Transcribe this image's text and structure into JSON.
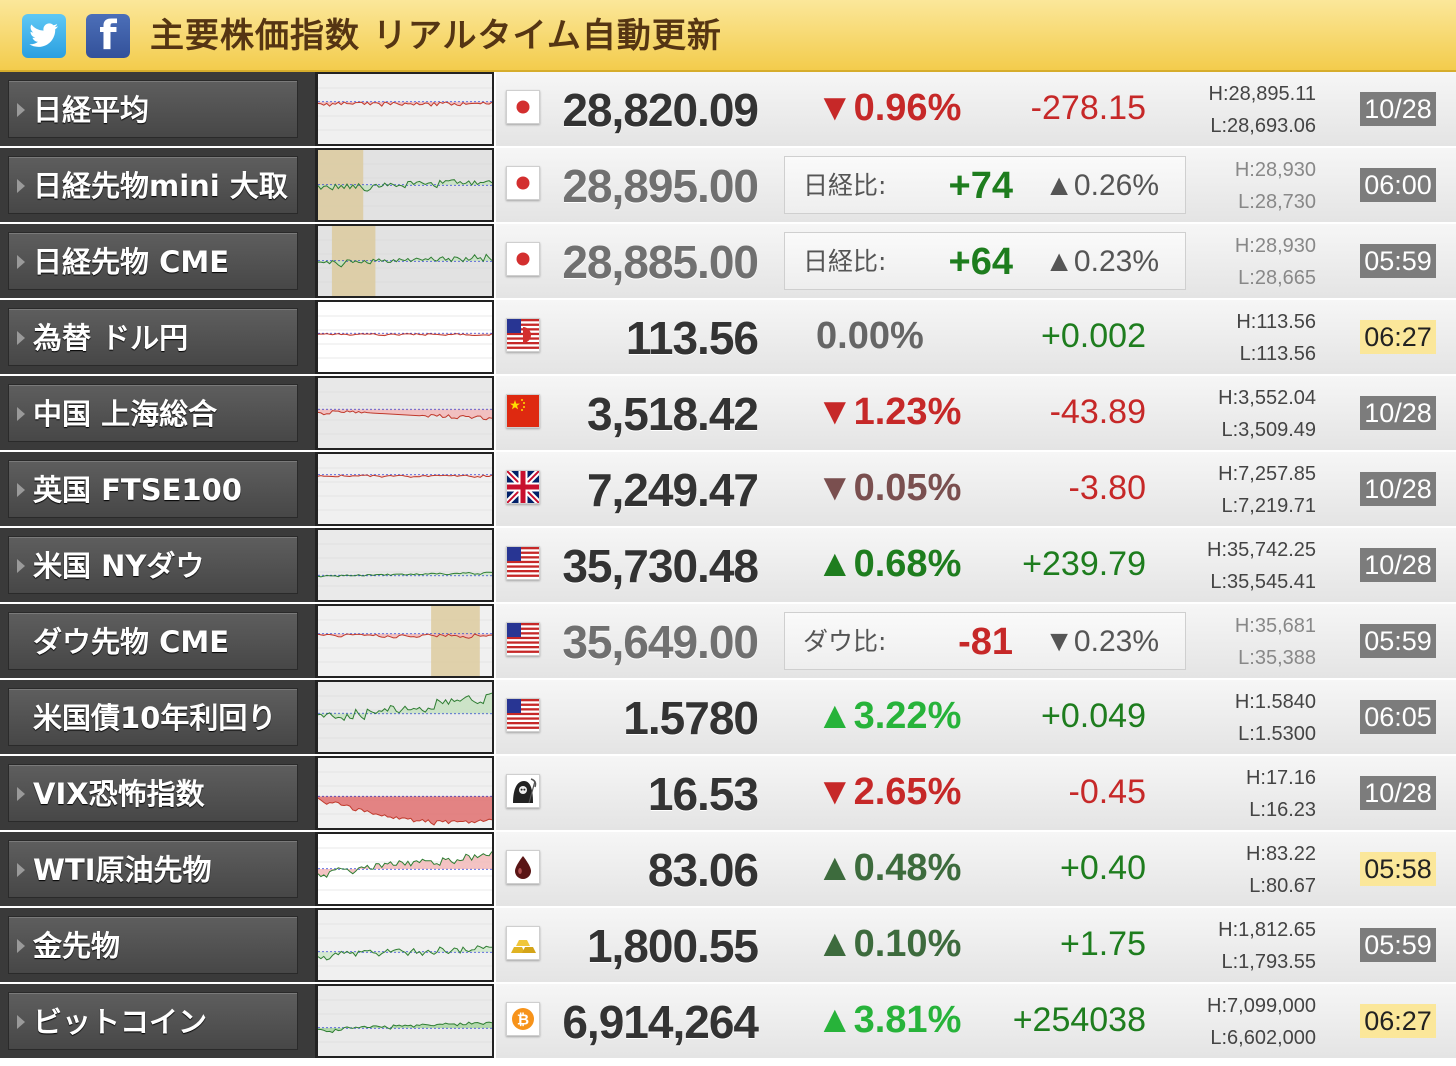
{
  "header": {
    "title": "主要株価指数 リアルタイム自動更新",
    "twitter_icon": "twitter-bird-icon",
    "facebook_icon": "facebook-f-icon",
    "facebook_letter": "f"
  },
  "colors": {
    "header_bg": "#f3cc4c",
    "header_text": "#553513",
    "down": "#c62828",
    "up": "#1e7d1e",
    "time_stale": "#7c7c7c",
    "time_live": "#fbe79a"
  },
  "rows": [
    {
      "name": "日経平均",
      "arrow": true,
      "flag": "jp",
      "price": "28,820.09",
      "price_style": "normal",
      "pct": "▼0.96%",
      "pct_style": "c-down",
      "chg": "-278.15",
      "chg_style": "c-down",
      "high": "H:28,895.11",
      "low": "L:28,693.06",
      "hl_dim": false,
      "time": "10/28",
      "time_live": false
    },
    {
      "name": "日経先物mini 大取",
      "arrow": true,
      "flag": "jp",
      "price": "28,895.00",
      "price_style": "futures",
      "cmp_label": "日経比:",
      "cmp_val": "+74",
      "cmp_style": "c-up",
      "cmp_pct": "▲0.26%",
      "high": "H:28,930",
      "low": "L:28,730",
      "hl_dim": true,
      "time": "06:00",
      "time_live": false
    },
    {
      "name": "日経先物 CME",
      "arrow": true,
      "flag": "jp",
      "price": "28,885.00",
      "price_style": "futures",
      "cmp_label": "日経比:",
      "cmp_val": "+64",
      "cmp_style": "c-up",
      "cmp_pct": "▲0.23%",
      "high": "H:28,930",
      "low": "L:28,665",
      "hl_dim": true,
      "time": "05:59",
      "time_live": false
    },
    {
      "name": "為替 ドル円",
      "arrow": true,
      "flag": "usjp",
      "price": "113.56",
      "price_style": "normal",
      "pct": "0.00%",
      "pct_style": "c-flat",
      "chg": "+0.002",
      "chg_style": "c-up",
      "high": "H:113.56",
      "low": "L:113.56",
      "hl_dim": false,
      "time": "06:27",
      "time_live": true
    },
    {
      "name": "中国 上海総合",
      "arrow": true,
      "flag": "cn",
      "price": "3,518.42",
      "price_style": "normal",
      "pct": "▼1.23%",
      "pct_style": "c-down",
      "chg": "-43.89",
      "chg_style": "c-down",
      "high": "H:3,552.04",
      "low": "L:3,509.49",
      "hl_dim": false,
      "time": "10/28",
      "time_live": false
    },
    {
      "name": "英国 FTSE100",
      "arrow": true,
      "flag": "uk",
      "price": "7,249.47",
      "price_style": "normal",
      "pct": "▼0.05%",
      "pct_style": "c-down-dim",
      "chg": "-3.80",
      "chg_style": "c-down",
      "high": "H:7,257.85",
      "low": "L:7,219.71",
      "hl_dim": false,
      "time": "10/28",
      "time_live": false
    },
    {
      "name": "米国 NYダウ",
      "arrow": true,
      "flag": "us",
      "price": "35,730.48",
      "price_style": "normal",
      "pct": "▲0.68%",
      "pct_style": "c-up",
      "chg": "+239.79",
      "chg_style": "c-up",
      "high": "H:35,742.25",
      "low": "L:35,545.41",
      "hl_dim": false,
      "time": "10/28",
      "time_live": false
    },
    {
      "name": "ダウ先物 CME",
      "arrow": false,
      "flag": "us",
      "price": "35,649.00",
      "price_style": "futures",
      "cmp_label": "ダウ比:",
      "cmp_val": "-81",
      "cmp_style": "c-down",
      "cmp_pct": "▼0.23%",
      "high": "H:35,681",
      "low": "L:35,388",
      "hl_dim": true,
      "time": "05:59",
      "time_live": false
    },
    {
      "name": "米国債10年利回り",
      "arrow": false,
      "flag": "us",
      "price": "1.5780",
      "price_style": "normal",
      "pct": "▲3.22%",
      "pct_style": "c-up-bright",
      "chg": "+0.049",
      "chg_style": "c-up",
      "high": "H:1.5840",
      "low": "L:1.5300",
      "hl_dim": false,
      "time": "06:05",
      "time_live": false
    },
    {
      "name": "VIX恐怖指数",
      "arrow": true,
      "flag": "reaper",
      "price": "16.53",
      "price_style": "normal",
      "pct": "▼2.65%",
      "pct_style": "c-down",
      "chg": "-0.45",
      "chg_style": "c-down",
      "high": "H:17.16",
      "low": "L:16.23",
      "hl_dim": false,
      "time": "10/28",
      "time_live": false
    },
    {
      "name": "WTI原油先物",
      "arrow": true,
      "flag": "oil",
      "price": "83.06",
      "price_style": "normal",
      "pct": "▲0.48%",
      "pct_style": "c-up-dim",
      "chg": "+0.40",
      "chg_style": "c-up",
      "high": "H:83.22",
      "low": "L:80.67",
      "hl_dim": false,
      "time": "05:58",
      "time_live": true
    },
    {
      "name": "金先物",
      "arrow": true,
      "flag": "gold",
      "price": "1,800.55",
      "price_style": "normal",
      "pct": "▲0.10%",
      "pct_style": "c-up-dim",
      "chg": "+1.75",
      "chg_style": "c-up",
      "high": "H:1,812.65",
      "low": "L:1,793.55",
      "hl_dim": false,
      "time": "05:59",
      "time_live": false
    },
    {
      "name": "ビットコイン",
      "arrow": true,
      "flag": "btc",
      "price": "6,914,264",
      "price_style": "normal",
      "pct": "▲3.81%",
      "pct_style": "c-up-bright",
      "chg": "+254038",
      "chg_style": "c-up",
      "high": "H:7,099,000",
      "low": "L:6,602,000",
      "hl_dim": false,
      "time": "06:27",
      "time_live": true
    }
  ]
}
